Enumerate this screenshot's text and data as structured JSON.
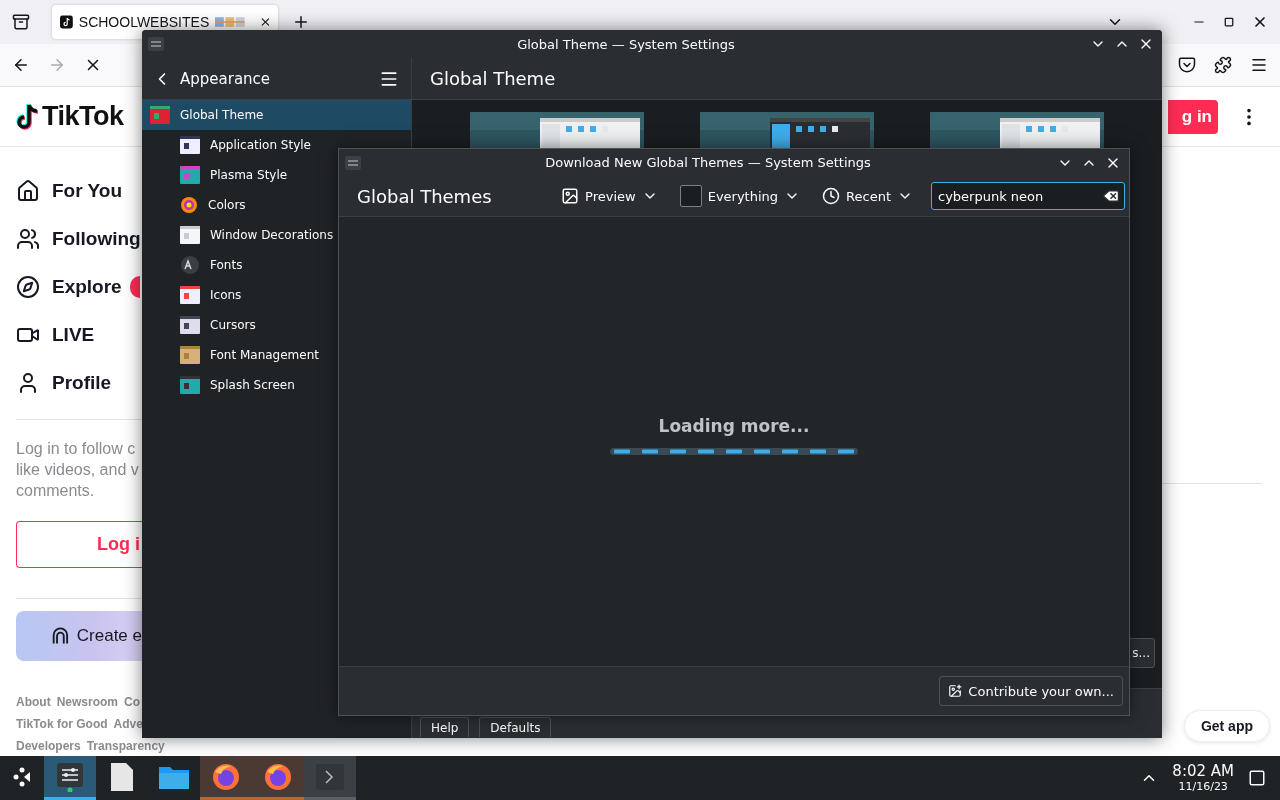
{
  "browser": {
    "tabs": [
      {
        "title": "SCHOOLWEBSITES",
        "selected": true
      }
    ]
  },
  "tiktok": {
    "logo": "TikTok",
    "login_button": "g in",
    "nav": [
      {
        "label": "For You"
      },
      {
        "label": "Following"
      },
      {
        "label": "Explore"
      },
      {
        "label": "LIVE"
      },
      {
        "label": "Profile"
      }
    ],
    "prompt": [
      "Log in to follow c",
      "like videos, and v",
      "comments."
    ],
    "login_cta": "Log i",
    "create_banner": "Create e",
    "footer_links": [
      [
        "About",
        "Newsroom",
        "Co"
      ],
      [
        "TikTok for Good",
        "Adve"
      ],
      [
        "Developers",
        "Transparency"
      ]
    ],
    "get_app": "Get app"
  },
  "settings": {
    "title": "Global Theme — System Settings",
    "back_label": "Appearance",
    "heading": "Global Theme",
    "sidebar": [
      {
        "label": "Global Theme",
        "selected": true
      },
      {
        "label": "Application Style",
        "selected": false
      },
      {
        "label": "Plasma Style",
        "selected": false
      },
      {
        "label": "Colors",
        "selected": false
      },
      {
        "label": "Window Decorations",
        "selected": false
      },
      {
        "label": "Fonts",
        "selected": false
      },
      {
        "label": "Icons",
        "selected": false
      },
      {
        "label": "Cursors",
        "selected": false
      },
      {
        "label": "Font Management",
        "selected": false
      },
      {
        "label": "Splash Screen",
        "selected": false
      }
    ],
    "buttons": [
      "Help",
      "Defaults"
    ],
    "side_button": "s..."
  },
  "dialog": {
    "title": "Download New Global Themes — System Settings",
    "heading": "Global Themes",
    "filters": [
      {
        "kind": "preview",
        "label": "Preview"
      },
      {
        "kind": "checkbox",
        "label": "Everything",
        "checked": false
      },
      {
        "kind": "sort",
        "label": "Recent"
      }
    ],
    "search": {
      "value": "cyberpunk neon"
    },
    "status": "Loading more...",
    "contribute": "Contribute your own..."
  },
  "taskbar": {
    "items": [
      {
        "kind": "settings",
        "selected": true,
        "open": true
      },
      {
        "kind": "file",
        "selected": false,
        "open": false
      },
      {
        "kind": "folder",
        "selected": false,
        "open": false
      },
      {
        "kind": "firefox",
        "selected": false,
        "open": true
      },
      {
        "kind": "firefox",
        "selected": false,
        "open": true
      },
      {
        "kind": "terminal",
        "selected": false,
        "open": true
      }
    ],
    "time": "8:02 AM",
    "date": "11/16/23"
  }
}
